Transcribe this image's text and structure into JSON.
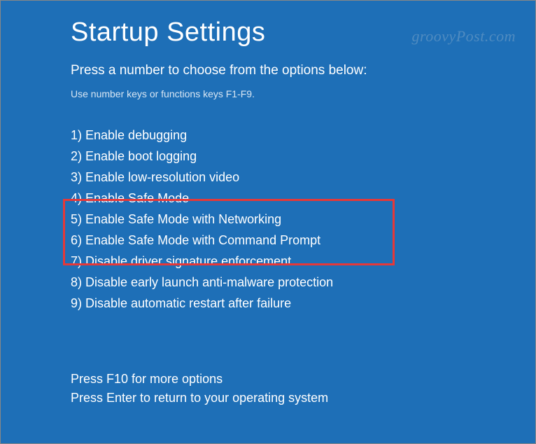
{
  "title": "Startup Settings",
  "subtitle": "Press a number to choose from the options below:",
  "hint": "Use number keys or functions keys F1-F9.",
  "options": [
    "1) Enable debugging",
    "2) Enable boot logging",
    "3) Enable low-resolution video",
    "4) Enable Safe Mode",
    "5) Enable Safe Mode with Networking",
    "6) Enable Safe Mode with Command Prompt",
    "7) Disable driver signature enforcement",
    "8) Disable early launch anti-malware protection",
    "9) Disable automatic restart after failure"
  ],
  "footer": {
    "more": "Press F10 for more options",
    "return": "Press Enter to return to your operating system"
  },
  "watermark": "groovyPost.com"
}
